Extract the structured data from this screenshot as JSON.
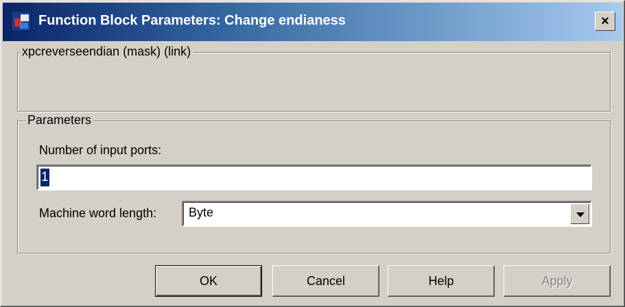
{
  "window": {
    "title": "Function Block Parameters: Change endianess",
    "close_label": "×",
    "title_gradient": [
      "#0a246a",
      "#a6caf0"
    ]
  },
  "mask_group": {
    "legend": "xpcreverseendian (mask) (link)"
  },
  "params_group": {
    "legend": "Parameters",
    "input_ports_label": "Number of input ports:",
    "input_ports_value": "1",
    "word_length_label": "Machine word length:",
    "word_length_value": "Byte"
  },
  "buttons": {
    "ok": "OK",
    "cancel": "Cancel",
    "help": "Help",
    "apply": "Apply"
  },
  "icons": {
    "app": "simulink-block-icon",
    "close": "close-icon",
    "dropdown": "chevron-down-icon"
  }
}
